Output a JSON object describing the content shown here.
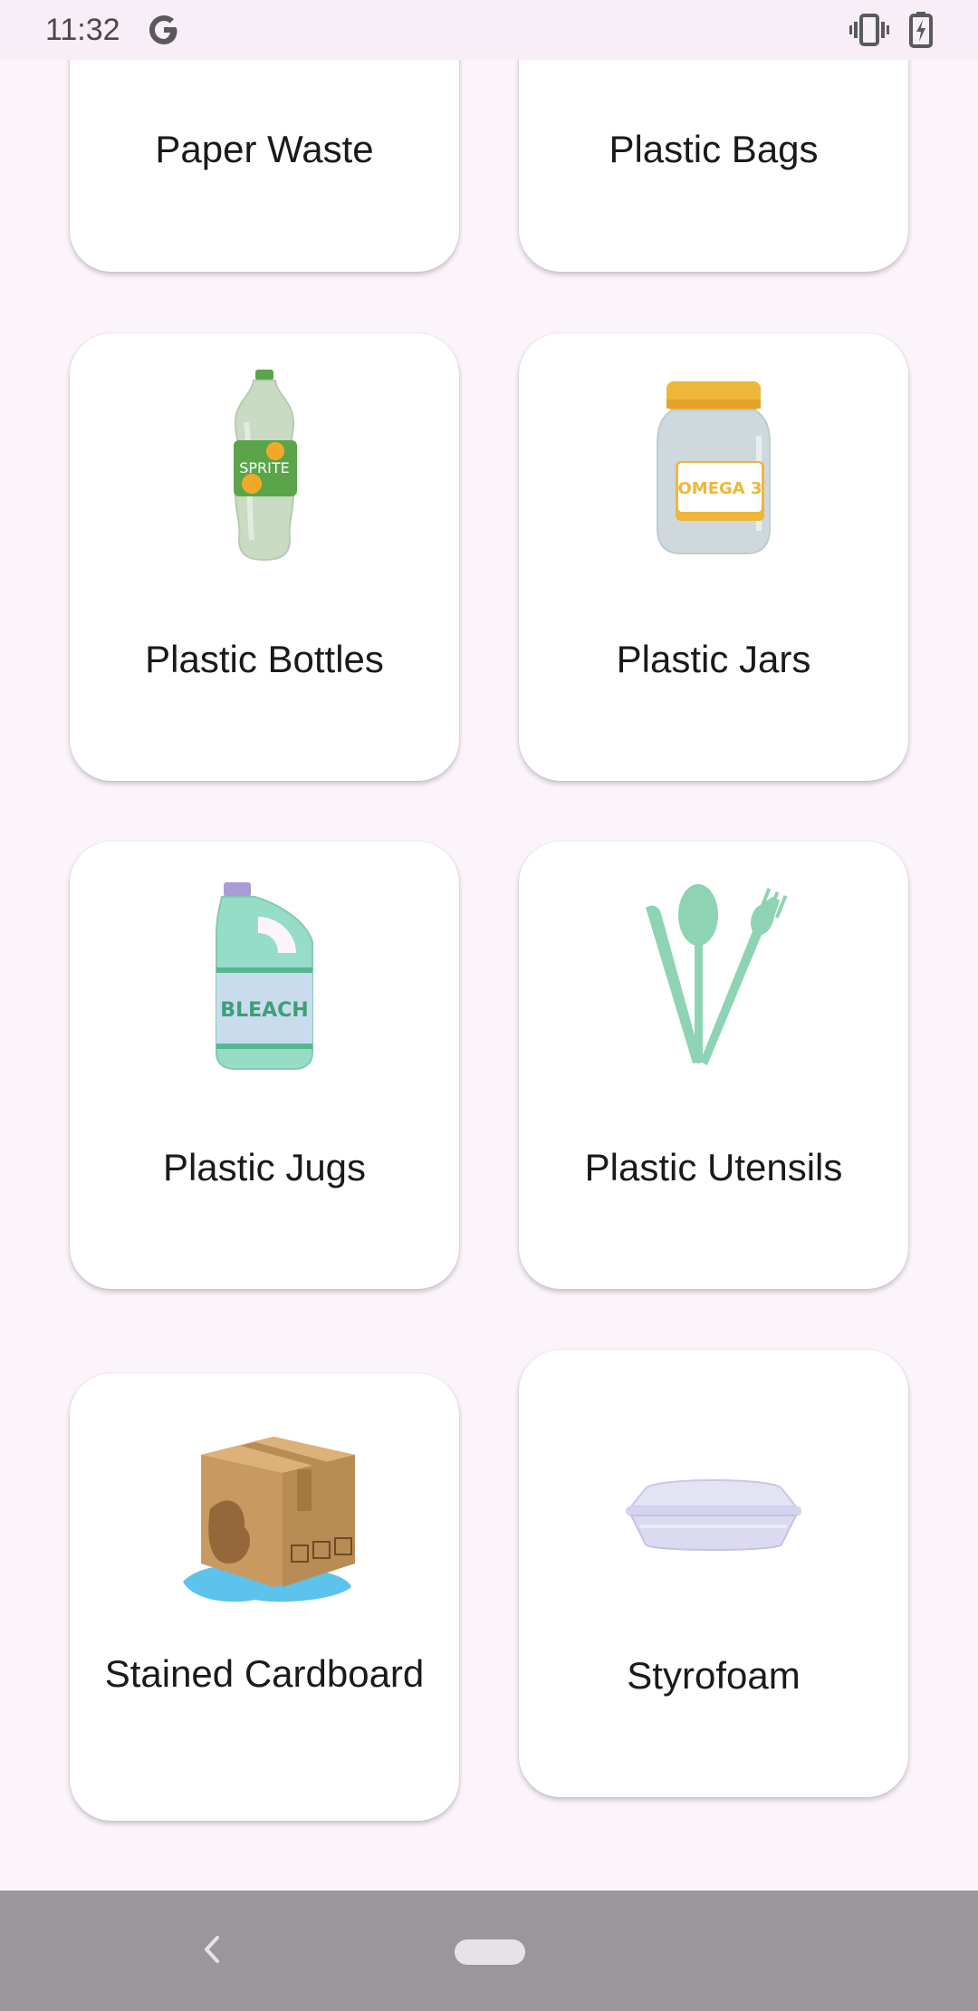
{
  "status_bar": {
    "time": "11:32",
    "icons": [
      "google-g-icon",
      "vibrate-icon",
      "battery-charging-icon"
    ]
  },
  "categories": [
    {
      "label": "Paper Waste",
      "icon": "paper-waste-image"
    },
    {
      "label": "Plastic Bags",
      "icon": "plastic-bags-image"
    },
    {
      "label": "Plastic Bottles",
      "icon": "plastic-bottle-image",
      "image_text": "SPRITE"
    },
    {
      "label": "Plastic Jars",
      "icon": "plastic-jar-image",
      "image_text": "OMEGA 3"
    },
    {
      "label": "Plastic Jugs",
      "icon": "plastic-jug-image",
      "image_text": "BLEACH"
    },
    {
      "label": "Plastic Utensils",
      "icon": "plastic-utensils-image"
    },
    {
      "label": "Stained Cardboard",
      "icon": "stained-cardboard-image"
    },
    {
      "label": "Styrofoam",
      "icon": "styrofoam-image"
    }
  ],
  "nav_bar": {
    "icons": [
      "back-icon",
      "home-pill-icon"
    ]
  },
  "colors": {
    "background": "#fcf4fb",
    "card": "#ffffff",
    "nav_bar": "#9a979c",
    "text": "#1a1a1a"
  }
}
